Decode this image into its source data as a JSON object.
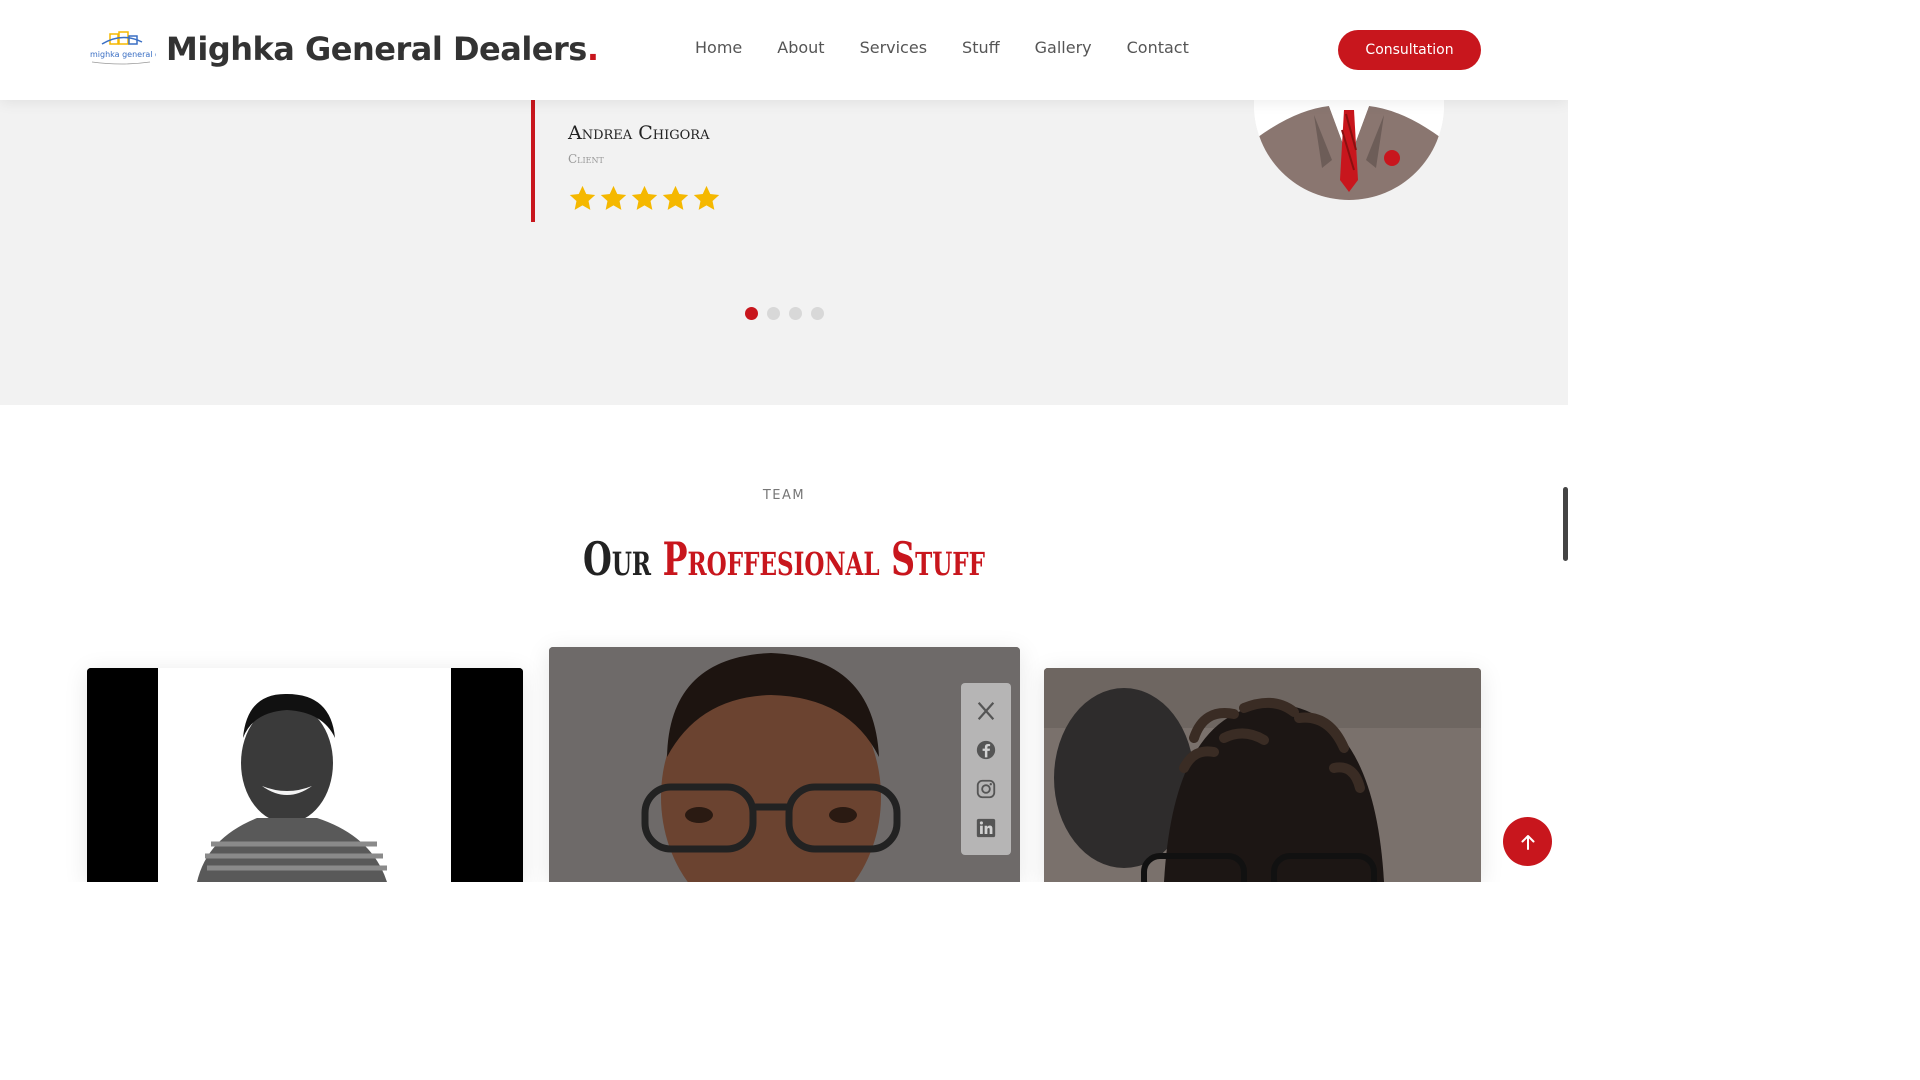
{
  "header": {
    "logo_text": "mighka general dealers",
    "brand_name": "Mighka General Dealers",
    "brand_dot": ".",
    "nav": [
      "Home",
      "About",
      "Services",
      "Stuff",
      "Gallery",
      "Contact"
    ],
    "cta_label": "Consultation"
  },
  "testimonial": {
    "name": "Andrea Chigora",
    "role": "Client",
    "rating": 5,
    "rating_max": 5,
    "carousel_total": 4,
    "carousel_active": 1
  },
  "team": {
    "kicker": "TEAM",
    "title_plain": "Our",
    "title_accent": "Proffesional Stuff",
    "social_icons": [
      "x-icon",
      "facebook-icon",
      "instagram-icon",
      "linkedin-icon"
    ]
  },
  "colors": {
    "accent": "#c8161d",
    "star": "#f5b800",
    "section_bg": "#f2f2f2"
  }
}
